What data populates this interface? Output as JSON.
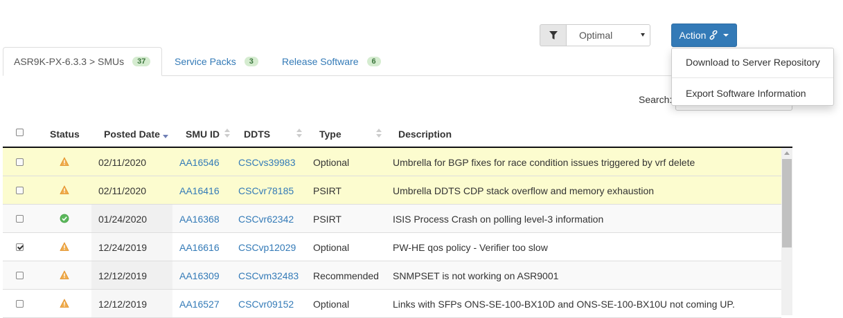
{
  "filter": {
    "icon": "filter-icon"
  },
  "select": {
    "value": "Optimal"
  },
  "action": {
    "label": "Action",
    "icon": "link-icon",
    "menu": [
      {
        "label": "Download to Server Repository"
      },
      {
        "label": "Export Software Information"
      }
    ]
  },
  "tabs": [
    {
      "label": "ASR9K-PX-6.3.3 > SMUs",
      "count": "37",
      "active": true
    },
    {
      "label": "Service Packs",
      "count": "3",
      "active": false
    },
    {
      "label": "Release Software",
      "count": "6",
      "active": false
    }
  ],
  "search": {
    "label": "Search:"
  },
  "table": {
    "headers": {
      "status": "Status",
      "posted_date": "Posted Date",
      "smu_id": "SMU ID",
      "ddts": "DDTS",
      "type": "Type",
      "description": "Description"
    },
    "sort": {
      "column": "Posted Date",
      "direction": "descending"
    },
    "rows": [
      {
        "checked": false,
        "status": "warning",
        "posted_date": "02/11/2020",
        "smu_id": "AA16546",
        "ddts": "CSCvs39983",
        "type": "Optional",
        "description": "Umbrella for BGP fixes for race condition issues triggered by vrf delete",
        "highlight": true
      },
      {
        "checked": false,
        "status": "warning",
        "posted_date": "02/11/2020",
        "smu_id": "AA16416",
        "ddts": "CSCvr78185",
        "type": "PSIRT",
        "description": "Umbrella DDTS CDP stack overflow and memory exhaustion",
        "highlight": true
      },
      {
        "checked": false,
        "status": "ok",
        "posted_date": "01/24/2020",
        "smu_id": "AA16368",
        "ddts": "CSCvr62342",
        "type": "PSIRT",
        "description": "ISIS Process Crash on polling level-3 information",
        "highlight": false
      },
      {
        "checked": true,
        "status": "warning",
        "posted_date": "12/24/2019",
        "smu_id": "AA16616",
        "ddts": "CSCvp12029",
        "type": "Optional",
        "description": "PW-HE qos policy - Verifier too slow",
        "highlight": false
      },
      {
        "checked": false,
        "status": "warning",
        "posted_date": "12/12/2019",
        "smu_id": "AA16309",
        "ddts": "CSCvm32483",
        "type": "Recommended",
        "description": "SNMPSET is not working on ASR9001",
        "highlight": false
      },
      {
        "checked": false,
        "status": "warning",
        "posted_date": "12/12/2019",
        "smu_id": "AA16527",
        "ddts": "CSCvr09152",
        "type": "Optional",
        "description": "Links with SFPs ONS-SE-100-BX10D and ONS-SE-100-BX10U not coming UP.",
        "highlight": false
      }
    ]
  },
  "colors": {
    "accent": "#337ab7",
    "warning_row": "#fcfccf",
    "warning_icon": "#f0ad4e",
    "ok_icon": "#5cb85c",
    "badge_bg": "#d5ecd0"
  }
}
